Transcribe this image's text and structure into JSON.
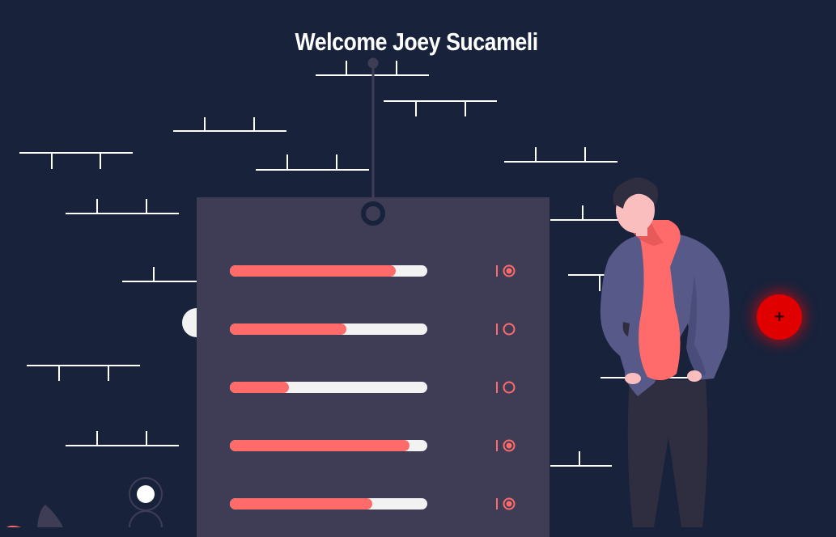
{
  "header": {
    "title": "Welcome Joey Sucameli"
  },
  "server": {
    "rows": [
      {
        "level": 0.84,
        "light": "on"
      },
      {
        "level": 0.59,
        "light": "off"
      },
      {
        "level": 0.3,
        "light": "off"
      },
      {
        "level": 0.91,
        "light": "on"
      },
      {
        "level": 0.72,
        "light": "on"
      }
    ]
  },
  "fab": {
    "label": "+"
  },
  "colors": {
    "background": "#18223b",
    "panel": "#3f3d56",
    "accent": "#ff6b6b",
    "track": "#f2f2f2",
    "fab": "#e00000",
    "jacket": "#575a89",
    "hoodie": "#ff6b6b",
    "pants": "#2f2e41"
  }
}
